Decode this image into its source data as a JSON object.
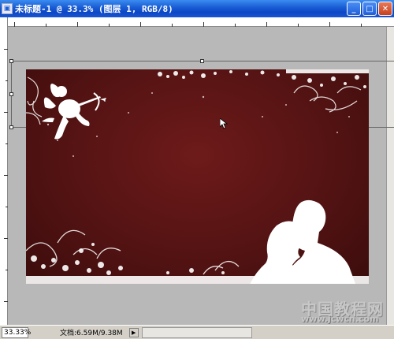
{
  "window": {
    "title": "未标题-1 @ 33.3% (图层 1, RGB/8)",
    "minimize_label": "_",
    "maximize_label": "□",
    "close_label": "✕"
  },
  "status": {
    "zoom": "33.33%",
    "doc_info": "文档:6.59M/9.38M",
    "arrow": "▶"
  },
  "watermark": {
    "text": "中国教程网",
    "url": "www.jcwcn.com"
  },
  "colors": {
    "canvas_bg": "#5a1414",
    "pasteboard": "#b8b8b8",
    "titlebar": "#1c5fd6"
  },
  "icons": [
    "document-icon",
    "minimize-icon",
    "maximize-icon",
    "close-icon",
    "cupid-silhouette-icon",
    "couple-silhouette-icon",
    "arrow-cursor-icon"
  ]
}
